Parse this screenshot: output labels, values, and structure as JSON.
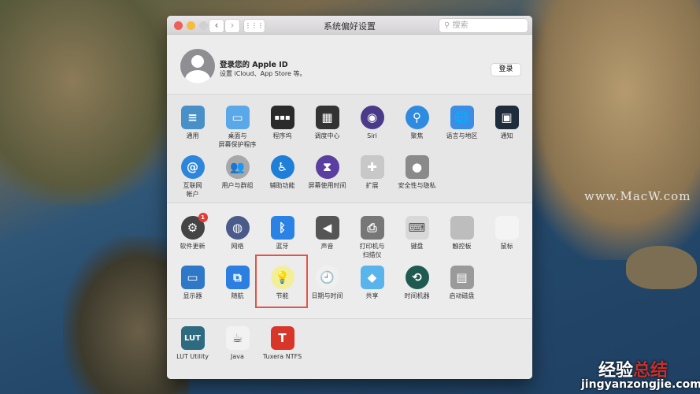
{
  "window": {
    "title": "系统偏好设置",
    "search_placeholder": "搜索",
    "back": "‹",
    "forward": "›",
    "grid": "⋮⋮⋮"
  },
  "account": {
    "title": "登录您的 Apple ID",
    "subtitle": "设置 iCloud、App Store 等。",
    "login_button": "登录"
  },
  "sections": [
    [
      [
        {
          "label": "通用",
          "icon": "general-icon",
          "color": "#4a90c8",
          "glyph": "≡"
        },
        {
          "label": "桌面与\n屏幕保护程序",
          "icon": "desktop-icon",
          "color": "#5aa8e8",
          "glyph": "▭"
        },
        {
          "label": "程序坞",
          "icon": "dock-icon",
          "color": "#2a2a2a",
          "glyph": "▪▪▪"
        },
        {
          "label": "调度中心",
          "icon": "mission-control-icon",
          "color": "#333333",
          "glyph": "▦"
        },
        {
          "label": "Siri",
          "icon": "siri-icon",
          "color": "#4b3a8a",
          "glyph": "◉",
          "round": true
        },
        {
          "label": "聚焦",
          "icon": "spotlight-icon",
          "color": "#2e8be0",
          "glyph": "⚲",
          "round": true
        },
        {
          "label": "语言与地区",
          "icon": "language-icon",
          "color": "#3a8ee6",
          "glyph": "🌐"
        },
        {
          "label": "通知",
          "icon": "notifications-icon",
          "color": "#1f2c3c",
          "glyph": "▣"
        }
      ],
      [
        {
          "label": "互联网\n帐户",
          "icon": "internet-accounts-icon",
          "color": "#2d86dc",
          "glyph": "@",
          "round": true
        },
        {
          "label": "用户与群组",
          "icon": "users-groups-icon",
          "color": "#a8a8a8",
          "glyph": "👥",
          "round": true
        },
        {
          "label": "辅助功能",
          "icon": "accessibility-icon",
          "color": "#1f7fd8",
          "glyph": "♿",
          "round": true
        },
        {
          "label": "屏幕使用时间",
          "icon": "screen-time-icon",
          "color": "#5a3fa0",
          "glyph": "⧗",
          "round": true
        },
        {
          "label": "扩展",
          "icon": "extensions-icon",
          "color": "#c8c8c8",
          "glyph": "✚"
        },
        {
          "label": "安全性与隐私",
          "icon": "security-icon",
          "color": "#8a8a8a",
          "glyph": "●"
        }
      ]
    ],
    [
      [
        {
          "label": "软件更新",
          "icon": "software-update-icon",
          "color": "#444444",
          "glyph": "⚙",
          "round": true,
          "badge": "1"
        },
        {
          "label": "网络",
          "icon": "network-icon",
          "color": "#4a5a8a",
          "glyph": "◍",
          "round": true
        },
        {
          "label": "蓝牙",
          "icon": "bluetooth-icon",
          "color": "#2a82e4",
          "glyph": "ᛒ"
        },
        {
          "label": "声音",
          "icon": "sound-icon",
          "color": "#555555",
          "glyph": "◀"
        },
        {
          "label": "打印机与\n扫描仪",
          "icon": "printer-icon",
          "color": "#777777",
          "glyph": "⎙"
        },
        {
          "label": "键盘",
          "icon": "keyboard-icon",
          "color": "#d8d8d8",
          "glyph": "⌨"
        },
        {
          "label": "触控板",
          "icon": "trackpad-icon",
          "color": "#bdbdbd",
          "glyph": ""
        },
        {
          "label": "鼠标",
          "icon": "mouse-icon",
          "color": "#f4f4f4",
          "glyph": ""
        }
      ],
      [
        {
          "label": "显示器",
          "icon": "displays-icon",
          "color": "#2f78c8",
          "glyph": "▭"
        },
        {
          "label": "随航",
          "icon": "sidecar-icon",
          "color": "#2c7fe0",
          "glyph": "⧉"
        },
        {
          "label": "节能",
          "icon": "energy-saver-icon",
          "color": "#f3ee9a",
          "glyph": "💡",
          "round": true,
          "highlight": true
        },
        {
          "label": "日期与时间",
          "icon": "date-time-icon",
          "color": "#f0f0f0",
          "glyph": "🕘",
          "round": true
        },
        {
          "label": "共享",
          "icon": "sharing-icon",
          "color": "#5ab4ec",
          "glyph": "◆"
        },
        {
          "label": "时间机器",
          "icon": "time-machine-icon",
          "color": "#1f5a50",
          "glyph": "⟲",
          "round": true
        },
        {
          "label": "启动磁盘",
          "icon": "startup-disk-icon",
          "color": "#9a9a9a",
          "glyph": "▤"
        }
      ]
    ],
    [
      [
        {
          "label": "LUT Utility",
          "icon": "lut-utility-icon",
          "color": "#2e6a80",
          "glyph": "LUT"
        },
        {
          "label": "Java",
          "icon": "java-icon",
          "color": "#f2f2f2",
          "glyph": "☕"
        },
        {
          "label": "Tuxera NTFS",
          "icon": "tuxera-ntfs-icon",
          "color": "#d9362a",
          "glyph": "T"
        }
      ]
    ]
  ],
  "watermarks": {
    "site": "www.MacW.com",
    "brand_a": "经验",
    "brand_b": "总结",
    "brand_url": "jingyanzongjie.com"
  }
}
